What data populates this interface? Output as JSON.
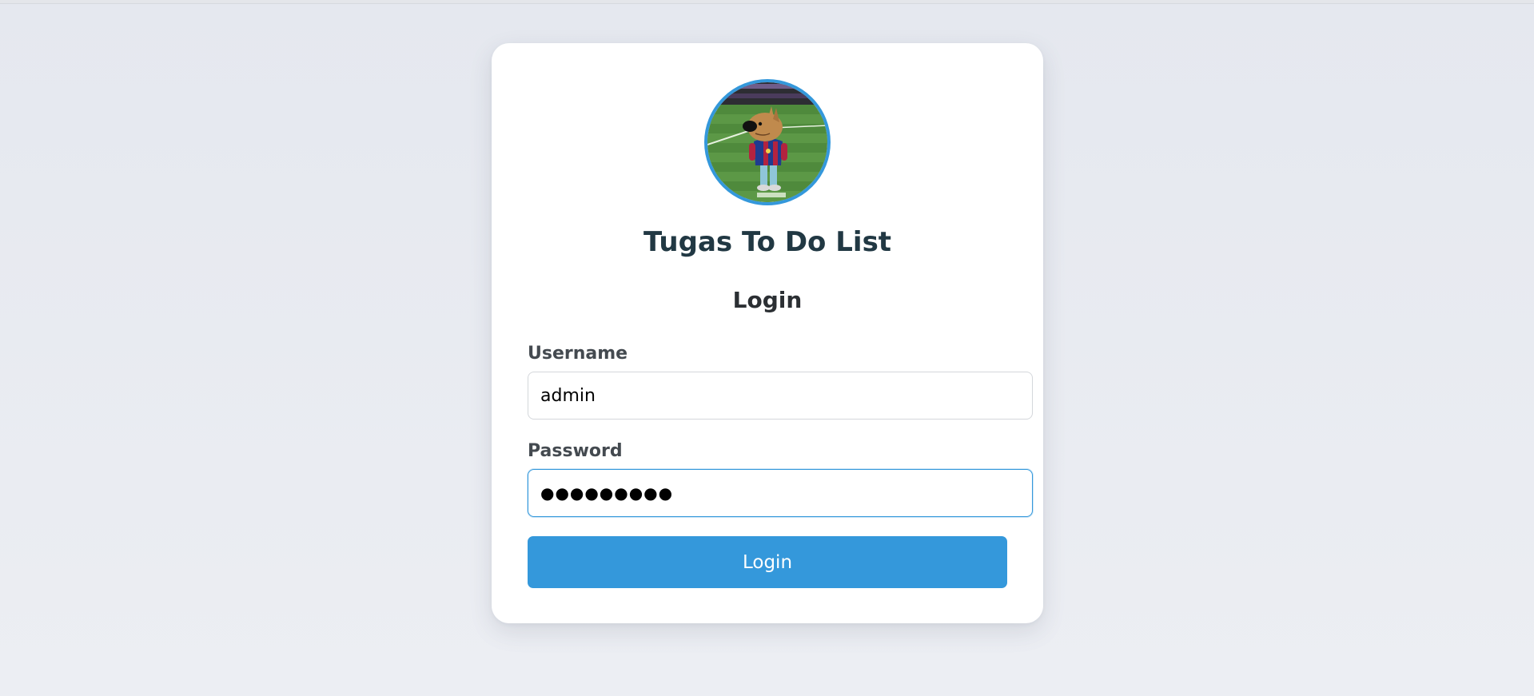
{
  "app": {
    "title": "Tugas To Do List"
  },
  "avatar": {
    "alt": "dog-cartoon-avatar"
  },
  "form": {
    "heading": "Login",
    "username": {
      "label": "Username",
      "value": "admin"
    },
    "password": {
      "label": "Password",
      "value": "●●●●●●●●●"
    },
    "submit_label": "Login"
  },
  "colors": {
    "accent": "#3498db",
    "title": "#213843",
    "background": "#e8eaf0"
  }
}
